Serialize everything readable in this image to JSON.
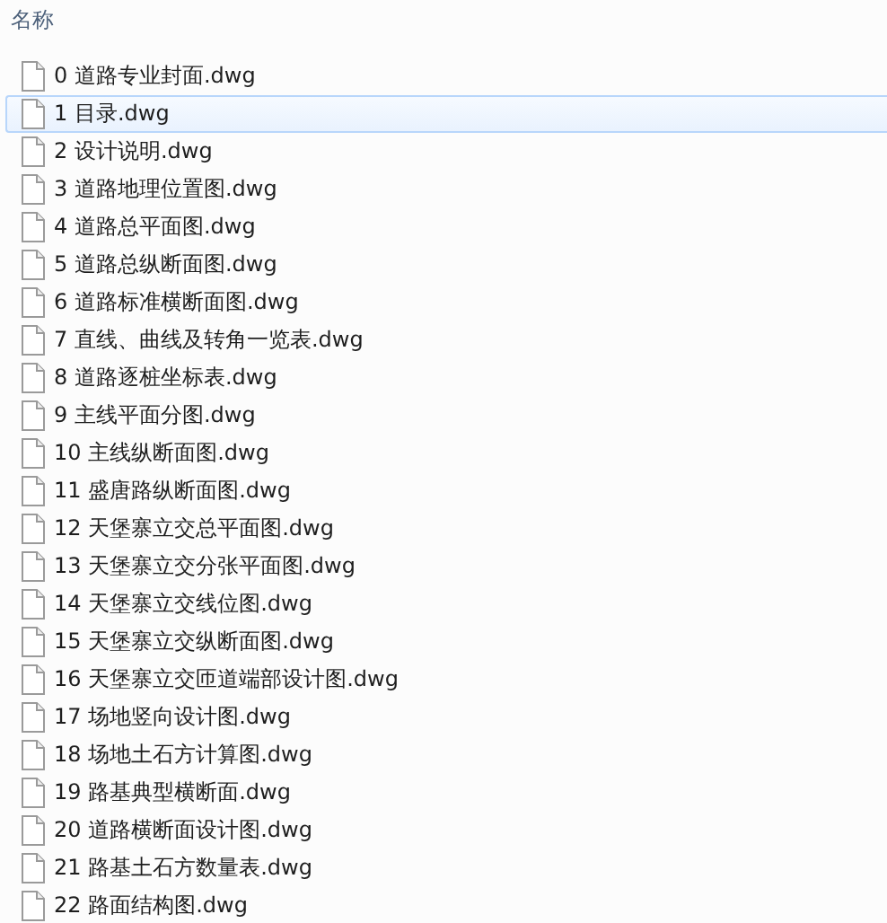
{
  "header": {
    "column_1": "名称"
  },
  "files": [
    {
      "name": "0 道路专业封面.dwg",
      "selected": false
    },
    {
      "name": "1 目录.dwg",
      "selected": true
    },
    {
      "name": "2 设计说明.dwg",
      "selected": false
    },
    {
      "name": "3 道路地理位置图.dwg",
      "selected": false
    },
    {
      "name": "4 道路总平面图.dwg",
      "selected": false
    },
    {
      "name": "5 道路总纵断面图.dwg",
      "selected": false
    },
    {
      "name": "6 道路标准横断面图.dwg",
      "selected": false
    },
    {
      "name": "7 直线、曲线及转角一览表.dwg",
      "selected": false
    },
    {
      "name": "8 道路逐桩坐标表.dwg",
      "selected": false
    },
    {
      "name": "9 主线平面分图.dwg",
      "selected": false
    },
    {
      "name": "10 主线纵断面图.dwg",
      "selected": false
    },
    {
      "name": "11 盛唐路纵断面图.dwg",
      "selected": false
    },
    {
      "name": "12 天堡寨立交总平面图.dwg",
      "selected": false
    },
    {
      "name": "13 天堡寨立交分张平面图.dwg",
      "selected": false
    },
    {
      "name": "14 天堡寨立交线位图.dwg",
      "selected": false
    },
    {
      "name": "15 天堡寨立交纵断面图.dwg",
      "selected": false
    },
    {
      "name": "16 天堡寨立交匝道端部设计图.dwg",
      "selected": false
    },
    {
      "name": "17 场地竖向设计图.dwg",
      "selected": false
    },
    {
      "name": "18 场地土石方计算图.dwg",
      "selected": false
    },
    {
      "name": "19 路基典型横断面.dwg",
      "selected": false
    },
    {
      "name": "20 道路横断面设计图.dwg",
      "selected": false
    },
    {
      "name": "21 路基土石方数量表.dwg",
      "selected": false
    },
    {
      "name": "22 路面结构图.dwg",
      "selected": false
    }
  ]
}
